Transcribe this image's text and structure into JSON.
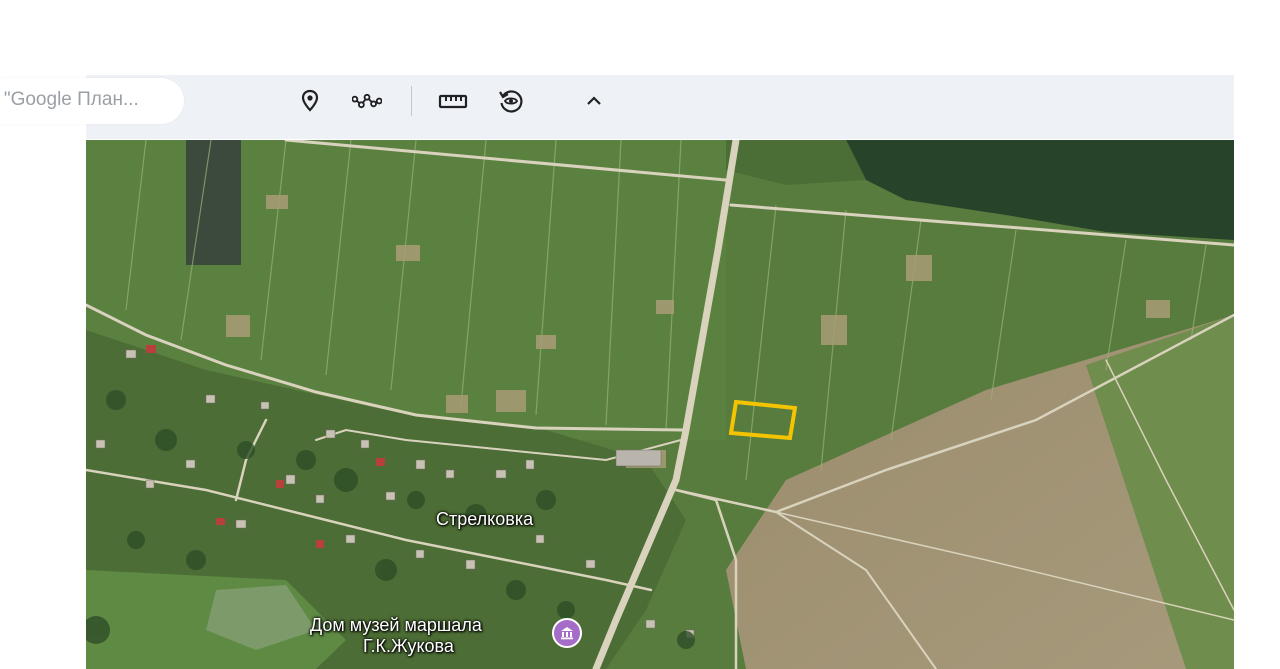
{
  "toolbar": {
    "search_text": "е \"Google План...",
    "icons": [
      "placemark-icon",
      "path-icon",
      "ruler-icon",
      "history-icon",
      "chevron-up-icon"
    ]
  },
  "map": {
    "labels": {
      "village": "Стрелковка",
      "museum_line1": "Дом музей маршала",
      "museum_line2": "Г.К.Жукова"
    },
    "poi_icon": "museum-icon",
    "highlight_color": "#f5c400"
  }
}
